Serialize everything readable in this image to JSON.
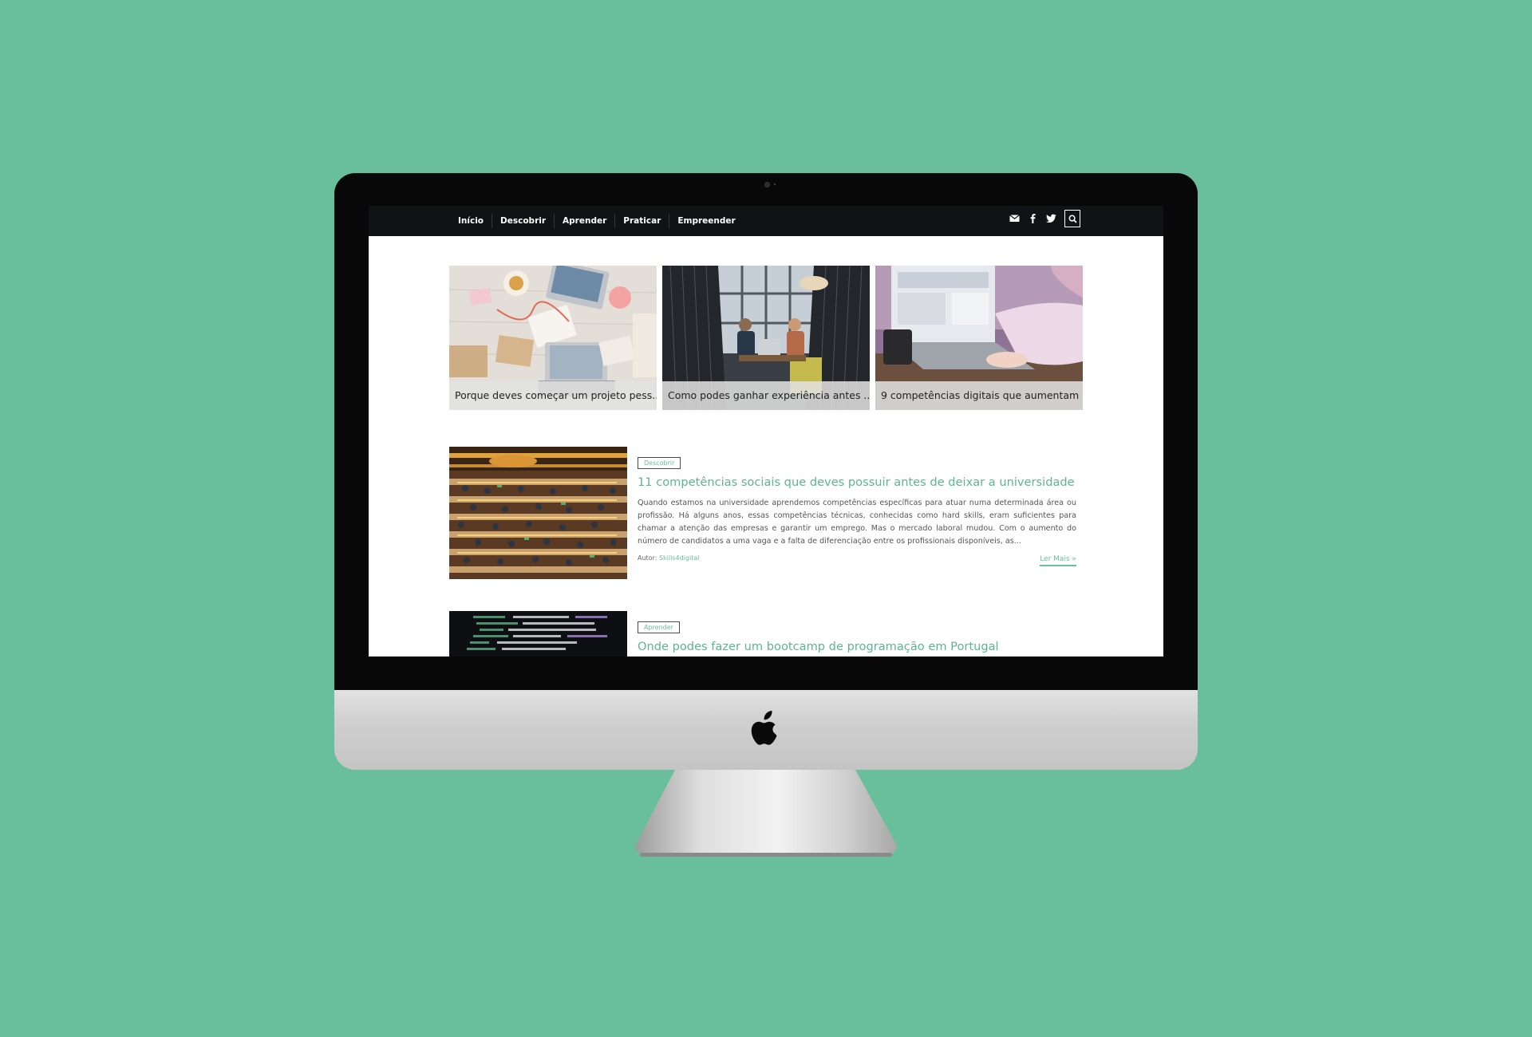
{
  "nav": {
    "items": [
      {
        "label": "Início"
      },
      {
        "label": "Descobrir"
      },
      {
        "label": "Aprender"
      },
      {
        "label": "Praticar"
      },
      {
        "label": "Empreender"
      }
    ],
    "icons": [
      "envelope-icon",
      "facebook-icon",
      "twitter-icon",
      "search-icon"
    ]
  },
  "featured": [
    {
      "caption": "Porque deves começar um projeto pess..."
    },
    {
      "caption": "Como podes ganhar experiência antes ..."
    },
    {
      "caption": "9 competências digitais que aumentam ..."
    }
  ],
  "posts": [
    {
      "tag": "Descobrir",
      "title": "11 competências sociais que deves possuir antes de deixar a universidade",
      "excerpt": "Quando estamos na universidade aprendemos competências específicas para atuar numa determinada área ou profissão. Há alguns anos, essas competências técnicas, conhecidas como hard skills, eram suficientes para chamar a atenção das empresas e garantir um emprego. Mas o mercado laboral mudou. Com o aumento do número de candidatos a uma vaga e a falta de diferenciação entre os profissionais disponíveis, as...",
      "author_label": "Autor:",
      "author": "Skills4digital",
      "read_more": "Ler Mais »"
    },
    {
      "tag": "Aprender",
      "title": "Onde podes fazer um bootcamp de programação em Portugal"
    }
  ],
  "colors": {
    "background": "#69bf9b",
    "accent": "#5cb58f",
    "navbar": "#111216"
  }
}
